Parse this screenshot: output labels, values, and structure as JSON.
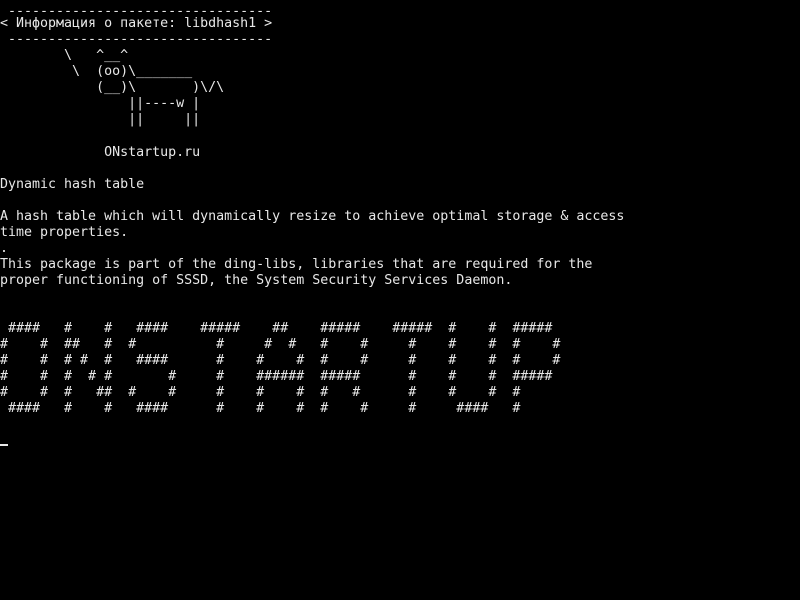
{
  "terminal": {
    "cowsay": {
      "bubble_top": " ---------------------------------",
      "bubble_text": "< Информация о пакете: libdhash1 >",
      "bubble_bottom": " ---------------------------------",
      "cow": [
        "        \\   ^__^",
        "         \\  (oo)\\_______",
        "            (__)\\       )\\/\\",
        "                ||----w |",
        "                ||     ||"
      ],
      "site": "             ONstartup.ru"
    },
    "package_info": {
      "summary": "Dynamic hash table",
      "description": [
        "A hash table which will dynamically resize to achieve optimal storage & access",
        "time properties.",
        ".",
        "This package is part of the ding-libs, libraries that are required for the",
        "proper functioning of SSSD, the System Security Services Daemon."
      ]
    },
    "banner": [
      " ####   #    #   ####    #####    ##    #####    #####  #    #  #####",
      "#    #  ##   #  #          #     #  #   #    #     #    #    #  #    #",
      "#    #  # #  #   ####      #    #    #  #    #     #    #    #  #    #",
      "#    #  #  # #       #     #    ######  #####      #    #    #  #####",
      "#    #  #   ##  #    #     #    #    #  #   #      #    #    #  #",
      " ####   #    #   ####      #    #    #  #    #     #     ####   #"
    ]
  }
}
